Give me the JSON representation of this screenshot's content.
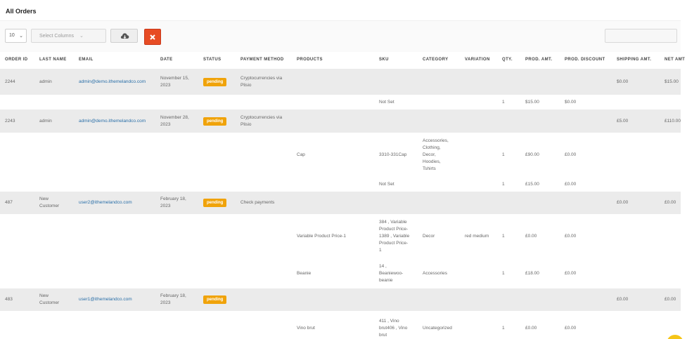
{
  "header": {
    "title": "All Orders"
  },
  "toolbar": {
    "page_size": "10",
    "columns_placeholder": "Select Columns",
    "download_icon": "cloud-download-icon",
    "close_icon": "close-icon",
    "accent": "#e74c24"
  },
  "columns": [
    "ORDER ID",
    "LAST NAME",
    "EMAIL",
    "DATE",
    "STATUS",
    "PAYMENT METHOD",
    "PRODUCTS",
    "SKU",
    "CATEGORY",
    "VARIATION",
    "QTY.",
    "PROD. AMT.",
    "PROD. DISCOUNT",
    "SHIPPING AMT.",
    "NET AMT"
  ],
  "colors": {
    "status_pending": "#f0a30a",
    "link": "#2a6fa8",
    "order_row_bg": "#ebebeb"
  },
  "rows": [
    {
      "type": "order",
      "order_id": "2244",
      "last_name": "admin",
      "email": "admin@demo.ithemelandco.com",
      "date": [
        "November 15,",
        "2023"
      ],
      "status": "pending",
      "payment": [
        "Cryptocurrencies via",
        "Plisio"
      ],
      "shipping": "$0.00",
      "net": "$15.00"
    },
    {
      "type": "item",
      "sku": [
        "Not Set"
      ],
      "qty": "1",
      "amt": "$15.00",
      "discount": "$0.00"
    },
    {
      "type": "order",
      "order_id": "2243",
      "last_name": "admin",
      "email": "admin@demo.ithemelandco.com",
      "date": [
        "November 28,",
        "2023"
      ],
      "status": "pending",
      "payment": [
        "Cryptocurrencies via",
        "Plisio"
      ],
      "shipping": "£5.00",
      "net": "£110.00"
    },
    {
      "type": "item",
      "product": "Cap",
      "sku": [
        "3310-331Cap"
      ],
      "category": [
        "Accessories,",
        "Clothing,",
        "Decor,",
        "Hoodies,",
        "Tshirts"
      ],
      "qty": "1",
      "amt": "£90.00",
      "discount": "£0.00"
    },
    {
      "type": "item",
      "sku": [
        "Not Set"
      ],
      "qty": "1",
      "amt": "£15.00",
      "discount": "£0.00"
    },
    {
      "type": "order",
      "order_id": "487",
      "last_name": [
        "New",
        "Customer"
      ],
      "email": "user2@ithemelandco.com",
      "date": [
        "February 18,",
        "2023"
      ],
      "status": "pending",
      "payment": [
        "Check payments"
      ],
      "shipping": "£0.00",
      "net": "£0.00"
    },
    {
      "type": "item",
      "product": "Variable Product Price-1",
      "sku": [
        "384 , Variable",
        "Product Price-",
        "1389 , Variable",
        "Product Price-",
        "1"
      ],
      "category": [
        "Decor"
      ],
      "variation": "red medium",
      "qty": "1",
      "amt": "£0.00",
      "discount": "£0.00"
    },
    {
      "type": "item",
      "product": "Beanie",
      "sku": [
        "14 ,",
        "Beaniewoo-",
        "beanie"
      ],
      "category": [
        "Accessories"
      ],
      "qty": "1",
      "amt": "£18.00",
      "discount": "£0.00"
    },
    {
      "type": "order",
      "order_id": "483",
      "last_name": [
        "New",
        "Customer"
      ],
      "email": "user1@ithemelandco.com",
      "date": [
        "February 18,",
        "2023"
      ],
      "status": "pending",
      "shipping": "£0.00",
      "net": "£0.00"
    },
    {
      "type": "item",
      "product": "Vino brut",
      "sku": [
        "411 , Vino",
        "brut406 , Vino",
        "brut"
      ],
      "category": [
        "Uncategorized"
      ],
      "qty": "1",
      "amt": "£0.00",
      "discount": "£0.00"
    }
  ]
}
